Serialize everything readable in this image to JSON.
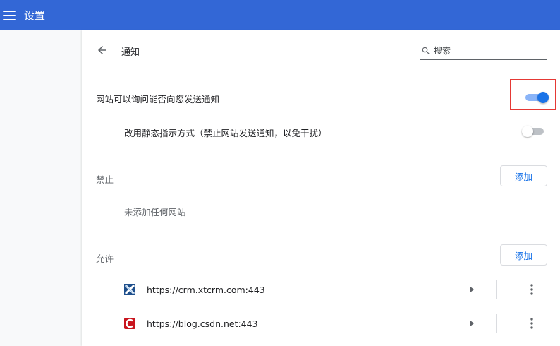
{
  "header": {
    "title": "设置",
    "background": "#3367d6",
    "menu_icon": "hamburger-menu-icon"
  },
  "notifications": {
    "title": "通知",
    "back_icon": "arrow-back-icon",
    "search": {
      "placeholder": "搜索",
      "icon": "search-icon"
    },
    "ask_setting": {
      "label": "网站可以询问能否向您发送通知",
      "enabled": true
    },
    "quiet_setting": {
      "label": "改用静态指示方式（禁止网站发送通知，以免干扰）",
      "enabled": false
    },
    "block_section": {
      "title": "禁止",
      "add_label": "添加",
      "empty_text": "未添加任何网站"
    },
    "allow_section": {
      "title": "允许",
      "add_label": "添加",
      "sites": [
        {
          "url": "https://crm.xtcrm.com:443",
          "favicon": "xtcrm-logo-icon",
          "favicon_color": "#1e4f8c"
        },
        {
          "url": "https://blog.csdn.net:443",
          "favicon": "csdn-logo-icon",
          "favicon_color": "#c9151e"
        }
      ]
    }
  },
  "colors": {
    "accent": "#1a73e8",
    "highlight": "#e53935"
  }
}
